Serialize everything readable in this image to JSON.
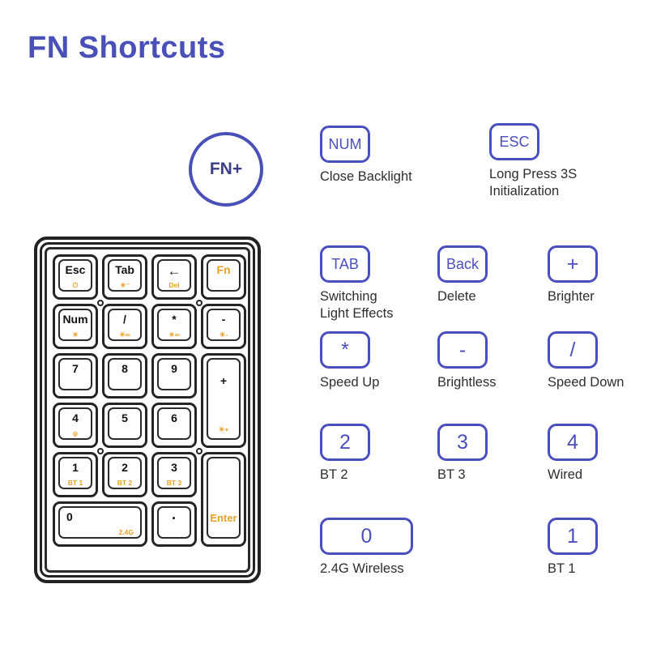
{
  "page": {
    "title": "FN Shortcuts",
    "accent_color": "#4a4fbf",
    "title_color": "#4950b8",
    "legend_color": "#e9a126",
    "background": "#ffffff"
  },
  "fn_badge": {
    "label": "FN+",
    "name": "fn-plus-circle"
  },
  "shortcuts": [
    {
      "key": "NUM",
      "caption": "Close Backlight",
      "icon": "num-key"
    },
    {
      "key": "ESC",
      "caption": "Long Press 3S\nInitialization",
      "icon": "esc-key"
    },
    {
      "key": "TAB",
      "caption": "Switching\nLight Effects",
      "icon": "tab-key"
    },
    {
      "key": "Back",
      "caption": "Delete",
      "icon": "backspace-key"
    },
    {
      "key": "+",
      "caption": "Brighter",
      "icon": "plus-key"
    },
    {
      "key": "*",
      "caption": "Speed Up",
      "icon": "asterisk-key"
    },
    {
      "key": "-",
      "caption": "Brightless",
      "icon": "minus-key"
    },
    {
      "key": "/",
      "caption": "Speed Down",
      "icon": "slash-key"
    },
    {
      "key": "2",
      "caption": "BT 2",
      "icon": "two-key"
    },
    {
      "key": "3",
      "caption": "BT 3",
      "icon": "three-key"
    },
    {
      "key": "4",
      "caption": "Wired",
      "icon": "four-key"
    },
    {
      "key": "0",
      "caption": "2.4G Wireless",
      "icon": "zero-key"
    },
    {
      "key": "1",
      "caption": "BT 1",
      "icon": "one-key"
    }
  ],
  "numpad": {
    "keys": [
      {
        "primary": "Esc",
        "secondary": "⏻"
      },
      {
        "primary": "Tab",
        "secondary": "☀⁻"
      },
      {
        "primary": "←",
        "secondary": "Del"
      },
      {
        "primary": "Fn",
        "secondary": ""
      },
      {
        "primary": "Num",
        "secondary": "☀"
      },
      {
        "primary": "/",
        "secondary": "☀∞"
      },
      {
        "primary": "*",
        "secondary": "☀∞"
      },
      {
        "primary": "-",
        "secondary": "☀-"
      },
      {
        "primary": "7",
        "secondary": ""
      },
      {
        "primary": "8",
        "secondary": ""
      },
      {
        "primary": "9",
        "secondary": ""
      },
      {
        "primary": "+",
        "secondary": "☀+"
      },
      {
        "primary": "4",
        "secondary": "ψ"
      },
      {
        "primary": "5",
        "secondary": ""
      },
      {
        "primary": "6",
        "secondary": ""
      },
      {
        "primary": "1",
        "secondary": "BT 1"
      },
      {
        "primary": "2",
        "secondary": "BT 2"
      },
      {
        "primary": "3",
        "secondary": "BT 3"
      },
      {
        "primary": "Enter",
        "secondary": ""
      },
      {
        "primary": "0",
        "secondary": "2.4G"
      },
      {
        "primary": "·",
        "secondary": ""
      }
    ]
  }
}
